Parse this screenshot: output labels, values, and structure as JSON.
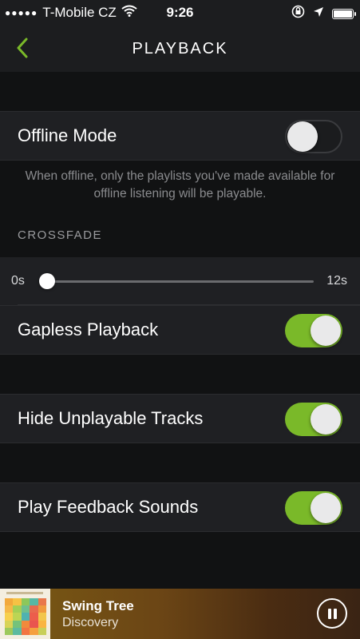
{
  "status_bar": {
    "signal": "●●●●●",
    "carrier": "T-Mobile CZ",
    "time": "9:26",
    "icons": [
      "wifi-icon",
      "orientation-lock-icon",
      "location-icon",
      "battery-icon"
    ]
  },
  "nav": {
    "back_icon": "chevron-left-icon",
    "title": "PLAYBACK"
  },
  "settings": {
    "offline_mode": {
      "label": "Offline Mode",
      "enabled": false
    },
    "offline_hint": "When offline, only the playlists you've made available for offline listening will be playable.",
    "crossfade": {
      "header": "CROSSFADE",
      "min_label": "0s",
      "max_label": "12s",
      "value": 0
    },
    "gapless": {
      "label": "Gapless Playback",
      "enabled": true
    },
    "hide_unplayable": {
      "label": "Hide Unplayable Tracks",
      "enabled": true
    },
    "feedback_sounds": {
      "label": "Play Feedback Sounds",
      "enabled": true
    }
  },
  "now_playing": {
    "title": "Swing Tree",
    "subtitle": "Discovery",
    "control": "pause-icon"
  },
  "colors": {
    "accent_green": "#7ab929",
    "background": "#111213",
    "row_background": "#1f2023"
  }
}
